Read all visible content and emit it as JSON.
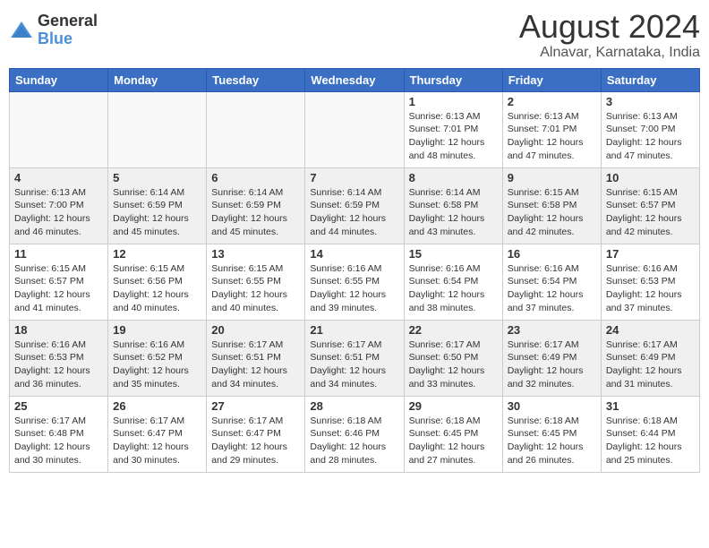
{
  "logo": {
    "general": "General",
    "blue": "Blue"
  },
  "title": {
    "month_year": "August 2024",
    "location": "Alnavar, Karnataka, India"
  },
  "days_of_week": [
    "Sunday",
    "Monday",
    "Tuesday",
    "Wednesday",
    "Thursday",
    "Friday",
    "Saturday"
  ],
  "weeks": [
    [
      {
        "num": "",
        "info": ""
      },
      {
        "num": "",
        "info": ""
      },
      {
        "num": "",
        "info": ""
      },
      {
        "num": "",
        "info": ""
      },
      {
        "num": "1",
        "info": "Sunrise: 6:13 AM\nSunset: 7:01 PM\nDaylight: 12 hours\nand 48 minutes."
      },
      {
        "num": "2",
        "info": "Sunrise: 6:13 AM\nSunset: 7:01 PM\nDaylight: 12 hours\nand 47 minutes."
      },
      {
        "num": "3",
        "info": "Sunrise: 6:13 AM\nSunset: 7:00 PM\nDaylight: 12 hours\nand 47 minutes."
      }
    ],
    [
      {
        "num": "4",
        "info": "Sunrise: 6:13 AM\nSunset: 7:00 PM\nDaylight: 12 hours\nand 46 minutes."
      },
      {
        "num": "5",
        "info": "Sunrise: 6:14 AM\nSunset: 6:59 PM\nDaylight: 12 hours\nand 45 minutes."
      },
      {
        "num": "6",
        "info": "Sunrise: 6:14 AM\nSunset: 6:59 PM\nDaylight: 12 hours\nand 45 minutes."
      },
      {
        "num": "7",
        "info": "Sunrise: 6:14 AM\nSunset: 6:59 PM\nDaylight: 12 hours\nand 44 minutes."
      },
      {
        "num": "8",
        "info": "Sunrise: 6:14 AM\nSunset: 6:58 PM\nDaylight: 12 hours\nand 43 minutes."
      },
      {
        "num": "9",
        "info": "Sunrise: 6:15 AM\nSunset: 6:58 PM\nDaylight: 12 hours\nand 42 minutes."
      },
      {
        "num": "10",
        "info": "Sunrise: 6:15 AM\nSunset: 6:57 PM\nDaylight: 12 hours\nand 42 minutes."
      }
    ],
    [
      {
        "num": "11",
        "info": "Sunrise: 6:15 AM\nSunset: 6:57 PM\nDaylight: 12 hours\nand 41 minutes."
      },
      {
        "num": "12",
        "info": "Sunrise: 6:15 AM\nSunset: 6:56 PM\nDaylight: 12 hours\nand 40 minutes."
      },
      {
        "num": "13",
        "info": "Sunrise: 6:15 AM\nSunset: 6:55 PM\nDaylight: 12 hours\nand 40 minutes."
      },
      {
        "num": "14",
        "info": "Sunrise: 6:16 AM\nSunset: 6:55 PM\nDaylight: 12 hours\nand 39 minutes."
      },
      {
        "num": "15",
        "info": "Sunrise: 6:16 AM\nSunset: 6:54 PM\nDaylight: 12 hours\nand 38 minutes."
      },
      {
        "num": "16",
        "info": "Sunrise: 6:16 AM\nSunset: 6:54 PM\nDaylight: 12 hours\nand 37 minutes."
      },
      {
        "num": "17",
        "info": "Sunrise: 6:16 AM\nSunset: 6:53 PM\nDaylight: 12 hours\nand 37 minutes."
      }
    ],
    [
      {
        "num": "18",
        "info": "Sunrise: 6:16 AM\nSunset: 6:53 PM\nDaylight: 12 hours\nand 36 minutes."
      },
      {
        "num": "19",
        "info": "Sunrise: 6:16 AM\nSunset: 6:52 PM\nDaylight: 12 hours\nand 35 minutes."
      },
      {
        "num": "20",
        "info": "Sunrise: 6:17 AM\nSunset: 6:51 PM\nDaylight: 12 hours\nand 34 minutes."
      },
      {
        "num": "21",
        "info": "Sunrise: 6:17 AM\nSunset: 6:51 PM\nDaylight: 12 hours\nand 34 minutes."
      },
      {
        "num": "22",
        "info": "Sunrise: 6:17 AM\nSunset: 6:50 PM\nDaylight: 12 hours\nand 33 minutes."
      },
      {
        "num": "23",
        "info": "Sunrise: 6:17 AM\nSunset: 6:49 PM\nDaylight: 12 hours\nand 32 minutes."
      },
      {
        "num": "24",
        "info": "Sunrise: 6:17 AM\nSunset: 6:49 PM\nDaylight: 12 hours\nand 31 minutes."
      }
    ],
    [
      {
        "num": "25",
        "info": "Sunrise: 6:17 AM\nSunset: 6:48 PM\nDaylight: 12 hours\nand 30 minutes."
      },
      {
        "num": "26",
        "info": "Sunrise: 6:17 AM\nSunset: 6:47 PM\nDaylight: 12 hours\nand 30 minutes."
      },
      {
        "num": "27",
        "info": "Sunrise: 6:17 AM\nSunset: 6:47 PM\nDaylight: 12 hours\nand 29 minutes."
      },
      {
        "num": "28",
        "info": "Sunrise: 6:18 AM\nSunset: 6:46 PM\nDaylight: 12 hours\nand 28 minutes."
      },
      {
        "num": "29",
        "info": "Sunrise: 6:18 AM\nSunset: 6:45 PM\nDaylight: 12 hours\nand 27 minutes."
      },
      {
        "num": "30",
        "info": "Sunrise: 6:18 AM\nSunset: 6:45 PM\nDaylight: 12 hours\nand 26 minutes."
      },
      {
        "num": "31",
        "info": "Sunrise: 6:18 AM\nSunset: 6:44 PM\nDaylight: 12 hours\nand 25 minutes."
      }
    ]
  ]
}
